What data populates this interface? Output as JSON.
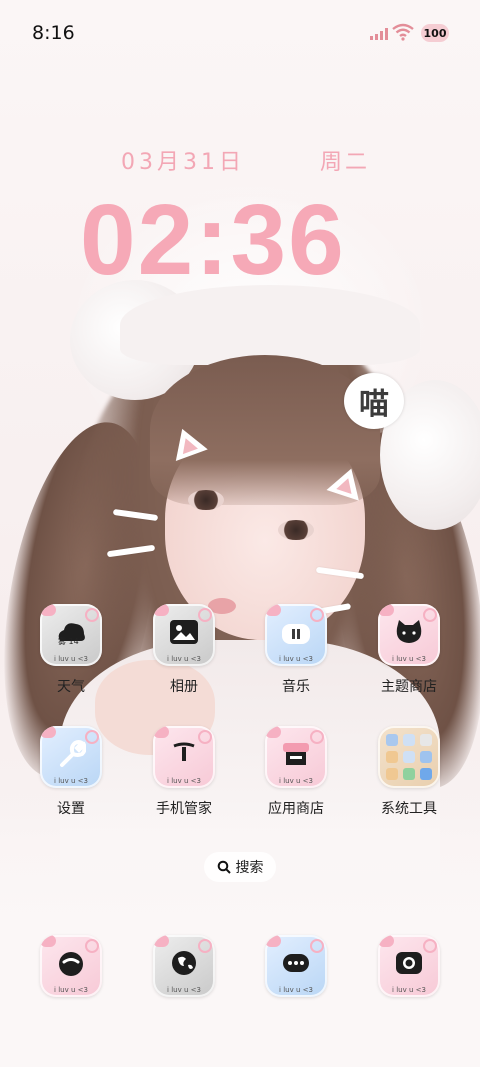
{
  "status_bar": {
    "time": "8:16",
    "battery": "100"
  },
  "clock_widget": {
    "date": "03月31日",
    "weekday": "周二",
    "time": "02:36"
  },
  "wallpaper": {
    "sticker_text": "喵"
  },
  "apps": [
    {
      "label": "天气",
      "tag": "i luv u <3",
      "weather_text": "雾 14°"
    },
    {
      "label": "相册",
      "tag": "i luv u <3"
    },
    {
      "label": "音乐",
      "tag": "i luv u <3"
    },
    {
      "label": "主题商店",
      "tag": "i luv u <3"
    },
    {
      "label": "设置",
      "tag": "i luv u <3"
    },
    {
      "label": "手机管家",
      "tag": "i luv u <3"
    },
    {
      "label": "应用商店",
      "tag": "i luv u <3"
    },
    {
      "label": "系统工具",
      "tag": ""
    }
  ],
  "search": {
    "label": "搜索"
  },
  "dock": [
    {
      "tag": "i luv u <3",
      "icon": "phone-icon"
    },
    {
      "tag": "i luv u <3",
      "icon": "browser-icon"
    },
    {
      "tag": "i luv u <3",
      "icon": "messages-icon"
    },
    {
      "tag": "i luv u <3",
      "icon": "camera-icon"
    }
  ],
  "colors": {
    "accent_pink": "#f6a9b7",
    "icon_pink": "#f7c9d6",
    "icon_blue": "#b9d6f5",
    "icon_gray": "#c9c9c9"
  }
}
